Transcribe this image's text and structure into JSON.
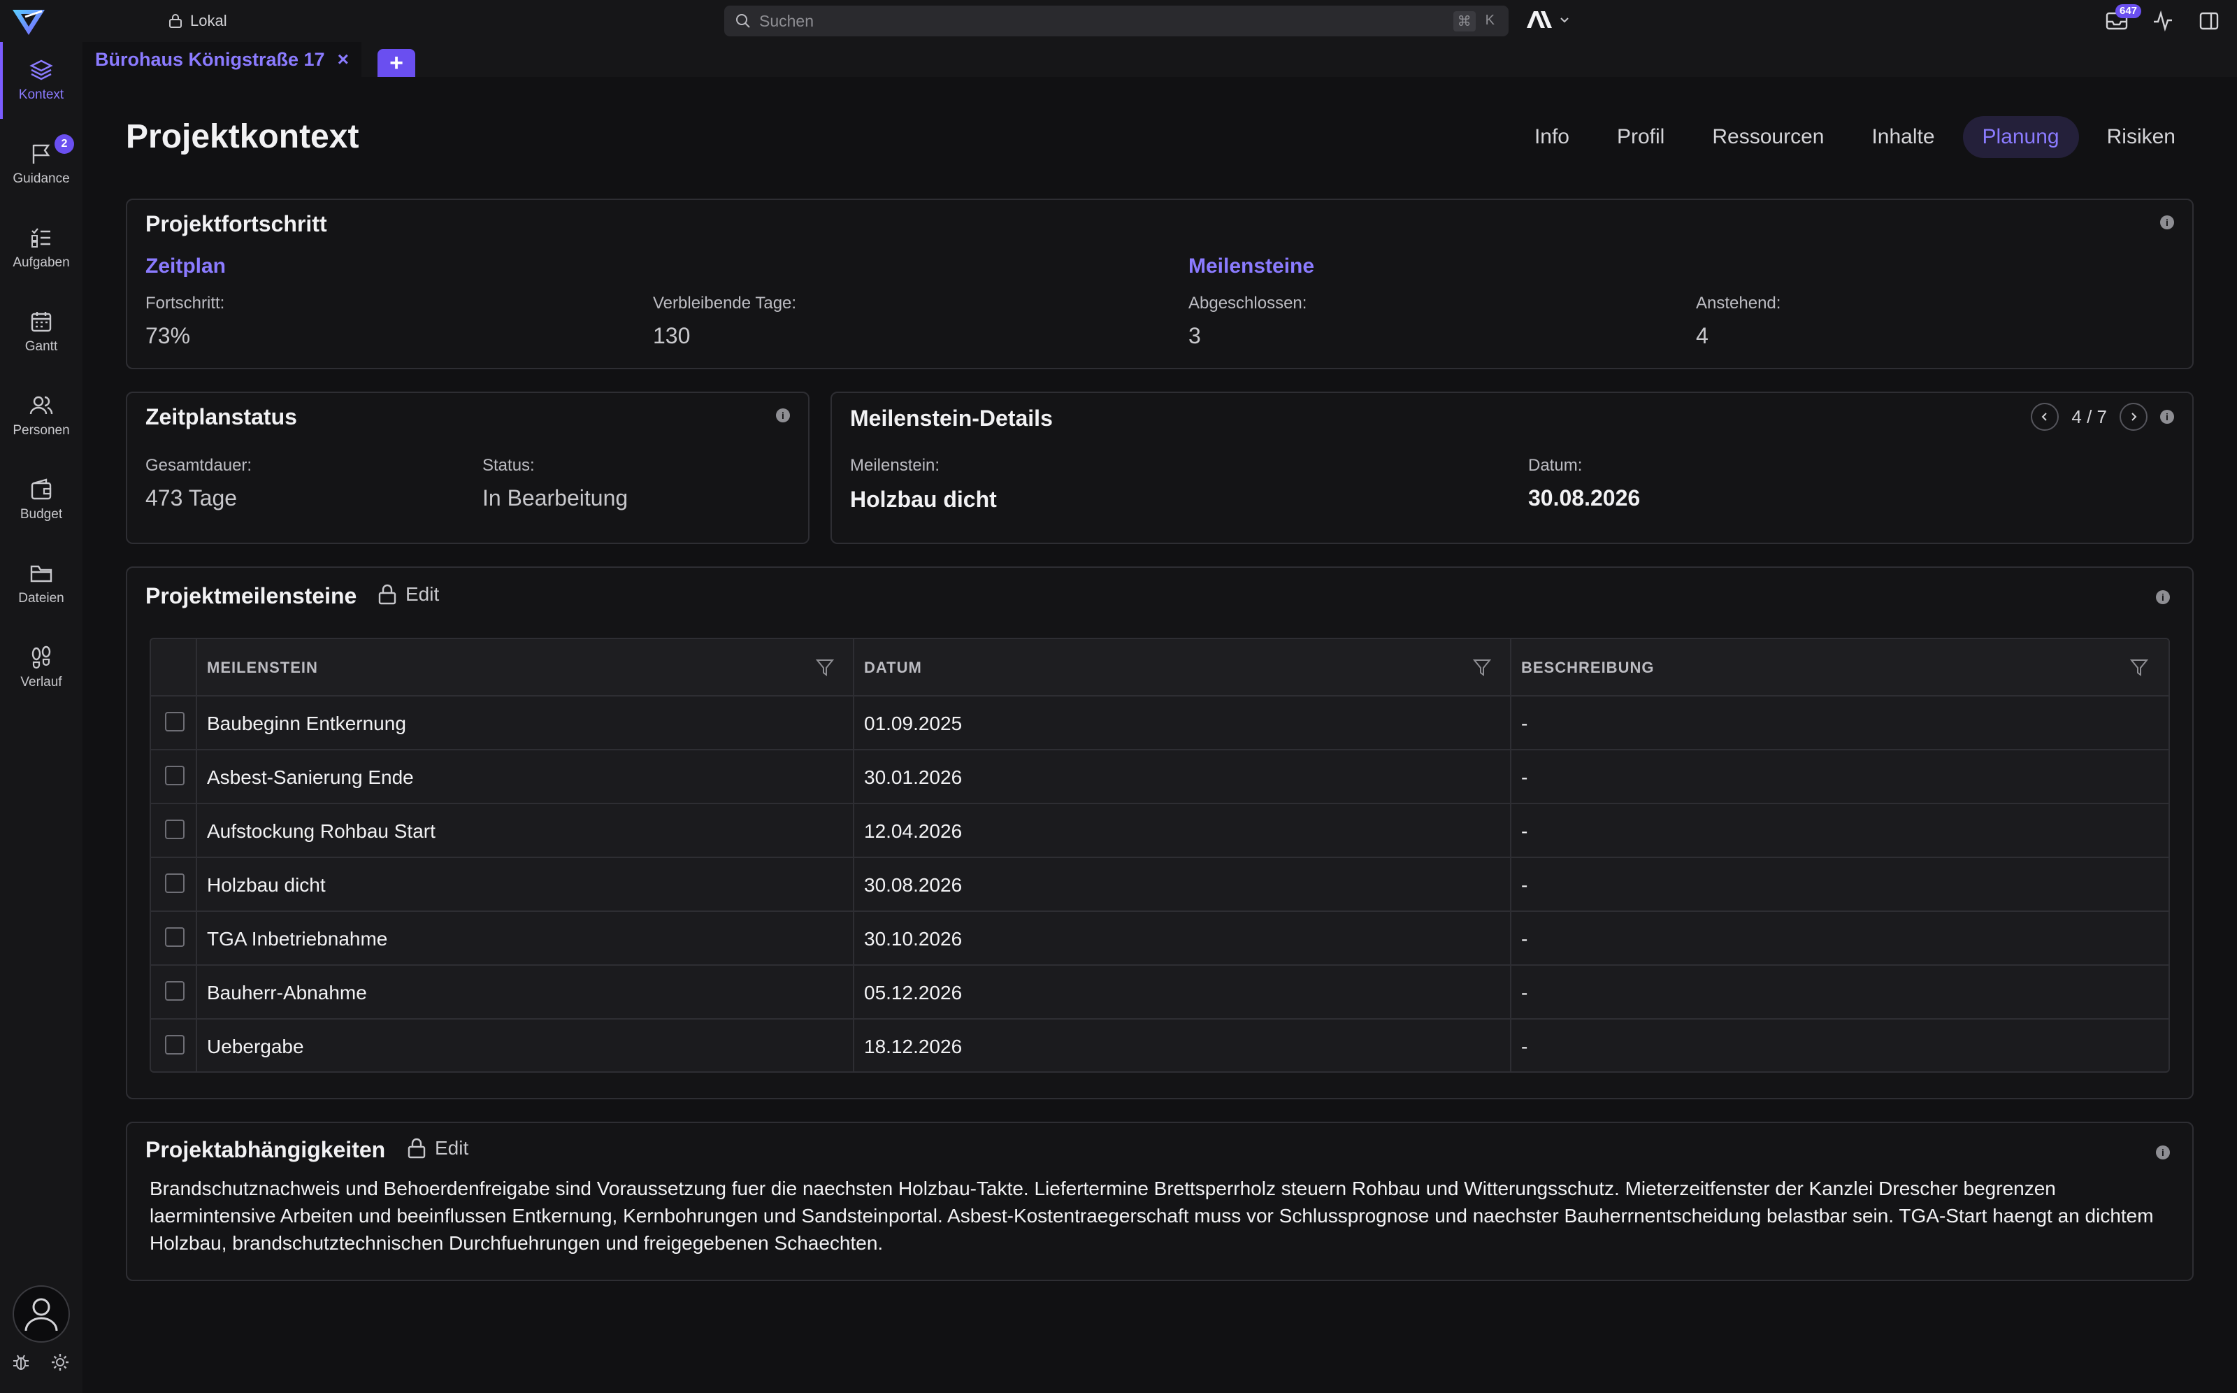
{
  "topbar": {
    "workspace_label": "Lokal",
    "search_placeholder": "Suchen",
    "shortcut_key1": "⌘",
    "shortcut_key2": "K",
    "notification_count": "647"
  },
  "sidebar": {
    "items": [
      {
        "label": "Kontext",
        "icon": "layers-icon",
        "active": true
      },
      {
        "label": "Guidance",
        "icon": "flag-icon",
        "badge": "2"
      },
      {
        "label": "Aufgaben",
        "icon": "checklist-icon"
      },
      {
        "label": "Gantt",
        "icon": "calendar-icon"
      },
      {
        "label": "Personen",
        "icon": "people-icon"
      },
      {
        "label": "Budget",
        "icon": "wallet-icon"
      },
      {
        "label": "Dateien",
        "icon": "folder-icon"
      },
      {
        "label": "Verlauf",
        "icon": "footsteps-icon"
      }
    ]
  },
  "tabs": {
    "active_tab": "Bürohaus Königstraße 17",
    "close": "×",
    "add": "+"
  },
  "page": {
    "title": "Projektkontext",
    "subnav": [
      "Info",
      "Profil",
      "Ressourcen",
      "Inhalte",
      "Planung",
      "Risiken"
    ],
    "subnav_active": "Planung"
  },
  "progress": {
    "title": "Projektfortschritt",
    "schedule_heading": "Zeitplan",
    "progress_label": "Fortschritt:",
    "progress_value": "73%",
    "remaining_label": "Verbleibende Tage:",
    "remaining_value": "130",
    "milestones_heading": "Meilensteine",
    "done_label": "Abgeschlossen:",
    "done_value": "3",
    "pending_label": "Anstehend:",
    "pending_value": "4"
  },
  "schedule_status": {
    "title": "Zeitplanstatus",
    "duration_label": "Gesamtdauer:",
    "duration_value": "473 Tage",
    "status_label": "Status:",
    "status_value": "In Bearbeitung"
  },
  "milestone_details": {
    "title": "Meilenstein-Details",
    "pager": "4 / 7",
    "milestone_label": "Meilenstein:",
    "milestone_value": "Holzbau dicht",
    "date_label": "Datum:",
    "date_value": "30.08.2026"
  },
  "milestones_table": {
    "title": "Projektmeilensteine",
    "edit_label": "Edit",
    "columns": [
      "MEILENSTEIN",
      "DATUM",
      "BESCHREIBUNG"
    ],
    "rows": [
      {
        "name": "Baubeginn Entkernung",
        "date": "01.09.2025",
        "desc": "-"
      },
      {
        "name": "Asbest-Sanierung Ende",
        "date": "30.01.2026",
        "desc": "-"
      },
      {
        "name": "Aufstockung Rohbau Start",
        "date": "12.04.2026",
        "desc": "-"
      },
      {
        "name": "Holzbau dicht",
        "date": "30.08.2026",
        "desc": "-"
      },
      {
        "name": "TGA Inbetriebnahme",
        "date": "30.10.2026",
        "desc": "-"
      },
      {
        "name": "Bauherr-Abnahme",
        "date": "05.12.2026",
        "desc": "-"
      },
      {
        "name": "Uebergabe",
        "date": "18.12.2026",
        "desc": "-"
      }
    ]
  },
  "dependencies": {
    "title": "Projektabhängigkeiten",
    "edit_label": "Edit",
    "text": "Brandschutznachweis und Behoerdenfreigabe sind Voraussetzung fuer die naechsten Holzbau-Takte. Liefertermine Brettsperrholz steuern Rohbau und Witterungsschutz. Mieterzeitfenster der Kanzlei Drescher begrenzen laermintensive Arbeiten und beeinflussen Entkernung, Kernbohrungen und Sandsteinportal. Asbest-Kostentraegerschaft muss vor Schlussprognose und naechster Bauherrnentscheidung belastbar sein. TGA-Start haengt an dichtem Holzbau, brandschutztechnischen Durchfuehrungen und freigegebenen Schaechten."
  },
  "colors": {
    "accent": "#7b5cff",
    "background": "#111113",
    "card": "#141416",
    "border": "#2e2e33"
  }
}
